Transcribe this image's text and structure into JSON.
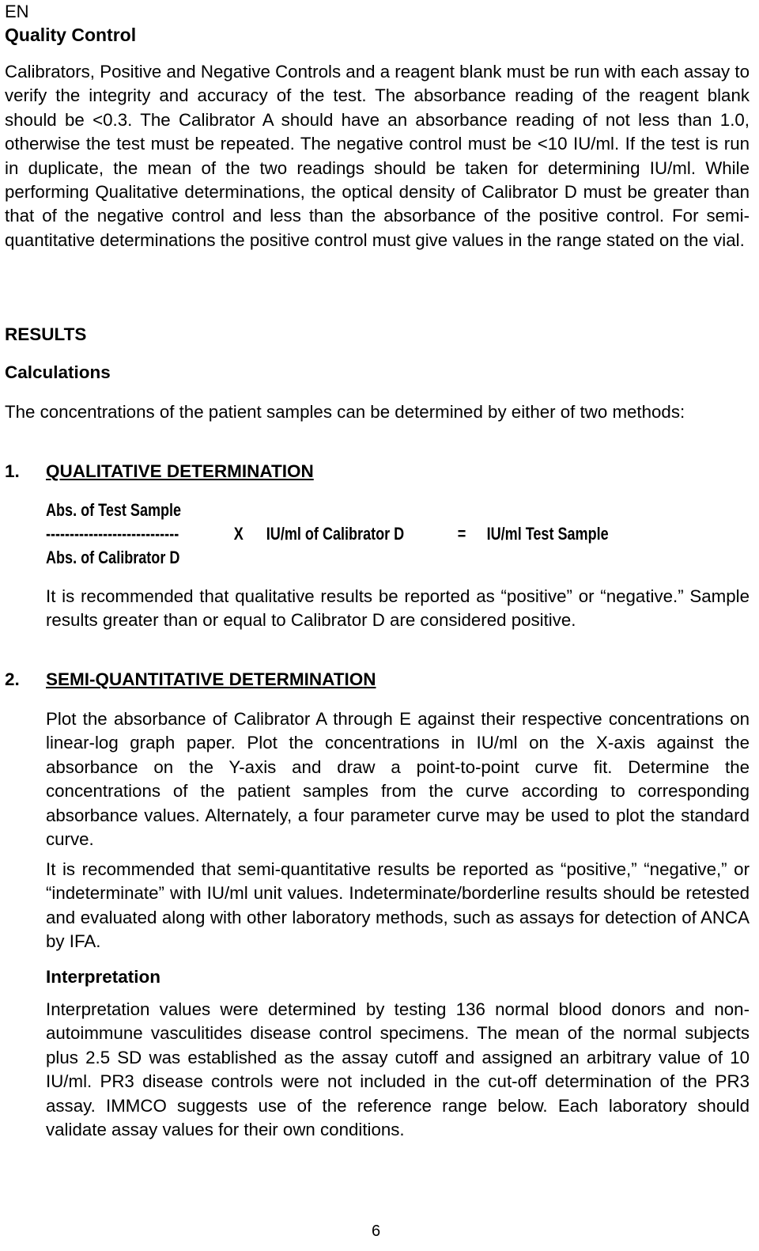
{
  "header": {
    "language": "EN",
    "section_title": "Quality Control"
  },
  "quality_control": {
    "paragraph": "Calibrators, Positive and Negative Controls and a reagent blank must be run with each assay to verify the integrity and accuracy of the test. The absorbance reading of the reagent blank should be <0.3. The Calibrator A should have an absorbance reading of not less than 1.0, otherwise the test must be repeated. The negative control must be <10 IU/ml. If the test is run in duplicate, the mean of the two readings should be taken for determining IU/ml. While performing Qualitative determinations, the optical density of Calibrator D must be greater than that of the negative control and less than the absorbance of the positive control. For semi-quantitative determinations the positive control must give values in the range stated on the vial."
  },
  "results": {
    "title": "RESULTS",
    "calculations_title": "Calculations",
    "intro": "The concentrations of the patient samples can be determined by either of two methods:",
    "qualitative": {
      "number": "1.",
      "title": "QUALITATIVE DETERMINATION",
      "formula": {
        "numerator": "Abs. of Test Sample",
        "fraction_line": "----------------------------",
        "times": "X",
        "multiplier": "IU/ml of Calibrator D",
        "equals": "=",
        "result": "IU/ml Test Sample",
        "denominator": "Abs. of Calibrator D"
      },
      "note": "It is recommended that qualitative results be reported as “positive” or “negative.” Sample results greater than or equal to Calibrator D are considered positive."
    },
    "semi_quantitative": {
      "number": "2.",
      "title": "SEMI-QUANTITATIVE DETERMINATION",
      "paragraph1": "Plot the absorbance of Calibrator A through E against their respective concentrations on linear-log graph paper. Plot the concentrations in IU/ml on the X-axis against the absorbance on the Y-axis and draw a point-to-point curve fit. Determine the concentrations of the patient samples from the curve according to corresponding absorbance values. Alternately, a four parameter curve may be used to plot the standard curve.",
      "paragraph2": "It is recommended that semi-quantitative results be reported as “positive,” “negative,” or “indeterminate” with IU/ml unit values. Indeterminate/borderline results should be retested and evaluated along with other laboratory methods, such as assays for detection of ANCA by IFA."
    },
    "interpretation": {
      "title": "Interpretation",
      "paragraph": "Interpretation values were determined by testing 136 normal blood donors and non-autoimmune vasculitides disease control specimens. The mean of the normal subjects plus 2.5 SD was established as the assay cutoff and assigned an arbitrary value of 10 IU/ml. PR3 disease controls were not included in the cut-off determination of the PR3 assay. IMMCO suggests use of the reference range below. Each laboratory should validate assay values for their own conditions."
    }
  },
  "footer": {
    "page_number": "6"
  }
}
